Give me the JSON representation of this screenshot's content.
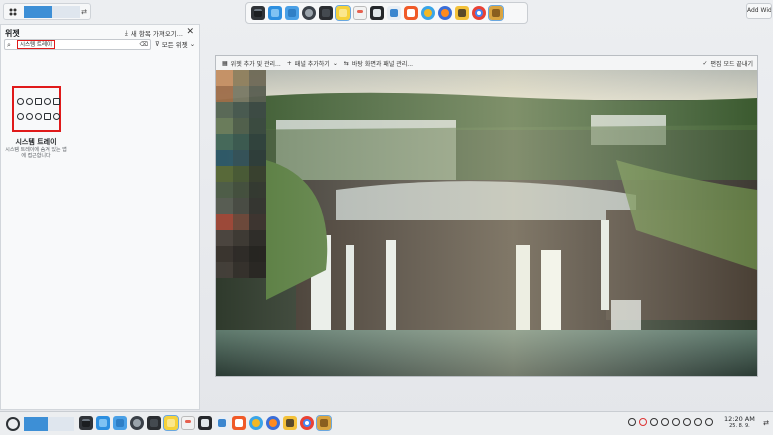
{
  "top_panel": {
    "handle_glyph": "⇄",
    "add_widgets_label": "Add Widgets",
    "dock_icons": [
      "terminal-icon",
      "store-icon",
      "files-icon",
      "settings-icon",
      "console-icon",
      "notes-icon",
      "calendar-icon",
      "photo-viewer-icon",
      "text-editor-icon",
      "brave-browser-icon",
      "circle-app-icon",
      "firefox-icon",
      "pencil-app-icon",
      "chrome-icon",
      "archive-icon"
    ]
  },
  "sidebar": {
    "title": "위젯",
    "get_new_label": "새 항목 가져오기...",
    "close_glyph": "✕",
    "search": {
      "value": "시스템 트레이",
      "placeholder": ""
    },
    "filter_label": "모든 위젯",
    "widget": {
      "name": "시스템 트레이",
      "description": "시스템 트레이에 숨겨 있는 앱에 접근합니다"
    }
  },
  "photo_toolbar": {
    "add_widget": "위젯 추가 및 관리...",
    "add_panel": "패널 추가하기",
    "screen_layout": "바탕 화면과 패널 관리...",
    "done": "편집 모드 끝내기"
  },
  "bottom_panel": {
    "time": "12:20 AM",
    "date": "25. 8. 9.",
    "end_glyph": "⇄"
  },
  "colors": {
    "accent": "#3d8fd6",
    "highlight_box": "#e01a1a"
  }
}
